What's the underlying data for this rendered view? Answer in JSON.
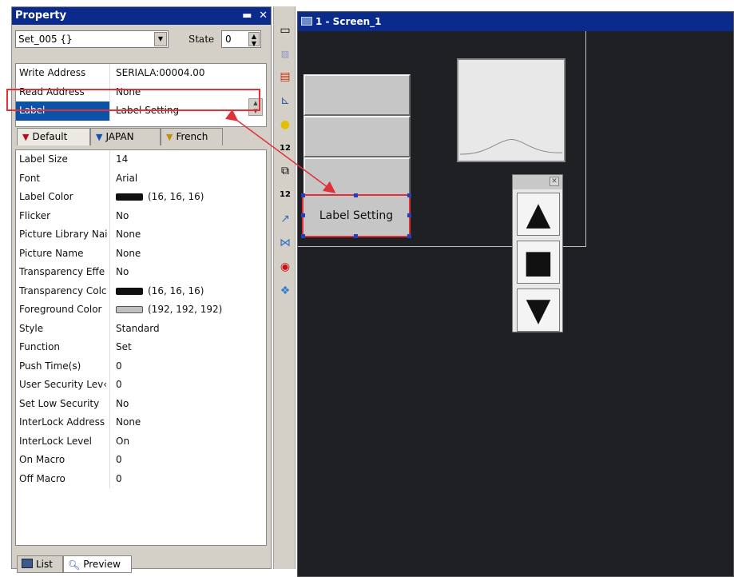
{
  "property_panel": {
    "title": "Property",
    "object_name": "Set_005 {}",
    "state_label": "State",
    "state_value": "0",
    "top_rows": [
      {
        "key": "Write Address",
        "value": "SERIALA:00004.00"
      },
      {
        "key": "Read Address",
        "value": "None"
      },
      {
        "key": "Label",
        "value": "Label Setting"
      }
    ],
    "language_tabs": [
      "Default",
      "JAPAN",
      "French"
    ],
    "rows": [
      {
        "key": "Label Size",
        "value": "14"
      },
      {
        "key": "Font",
        "value": "Arial"
      },
      {
        "key": "Label Color",
        "value": "(16, 16, 16)",
        "swatch": "#101010"
      },
      {
        "key": "Flicker",
        "value": "No"
      },
      {
        "key": "Picture Library Nai",
        "value": "None"
      },
      {
        "key": "Picture Name",
        "value": "None"
      },
      {
        "key": "Transparency Effe",
        "value": "No"
      },
      {
        "key": "Transparency Colc",
        "value": "(16, 16, 16)",
        "swatch": "#101010"
      },
      {
        "key": "Foreground Color",
        "value": "(192, 192, 192)",
        "swatch": "#c0c0c0"
      },
      {
        "key": "Style",
        "value": "Standard"
      },
      {
        "key": "Function",
        "value": "Set"
      },
      {
        "key": "Push Time(s)",
        "value": "0"
      },
      {
        "key": "User Security Lev‹",
        "value": "0"
      },
      {
        "key": "Set Low Security",
        "value": "No"
      },
      {
        "key": "InterLock Address",
        "value": "None"
      },
      {
        "key": "InterLock Level",
        "value": "On"
      },
      {
        "key": "On Macro",
        "value": "0"
      },
      {
        "key": "Off Macro",
        "value": "0"
      }
    ],
    "bottom_tabs": [
      "List",
      "Preview"
    ]
  },
  "screen_window": {
    "title": "1 - Screen_1",
    "selected_object_label": "Label Setting"
  },
  "colors": {
    "title_bar": "#0a2a8c",
    "selection": "#0a53a8",
    "highlight": "#e0303a",
    "screen_bg": "#1f2023"
  }
}
